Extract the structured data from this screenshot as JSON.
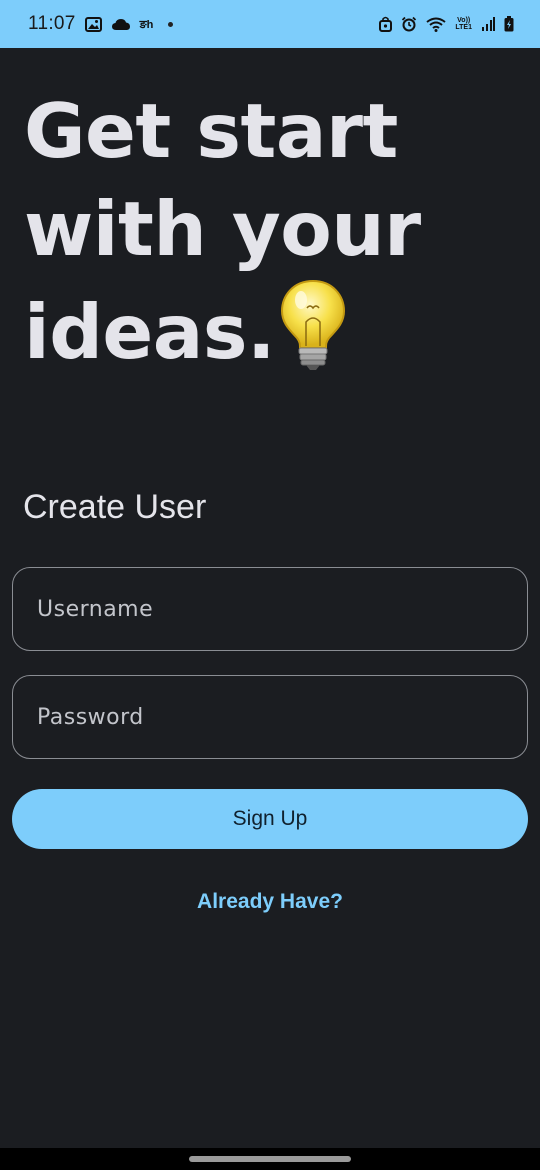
{
  "status_bar": {
    "time": "11:07",
    "bengali_glyph": "ङh",
    "volte_top": "Vo))",
    "volte_bottom": "LTE1",
    "background": "#7dcdfb"
  },
  "headline": {
    "line1": "Get start",
    "line2": "with your",
    "line3": "ideas.",
    "emoji_icon": "light-bulb-icon"
  },
  "form": {
    "title": "Create User",
    "username_placeholder": "Username",
    "username_value": "",
    "password_placeholder": "Password",
    "password_value": "",
    "signup_label": "Sign Up",
    "already_have_label": "Already Have?"
  },
  "colors": {
    "background": "#1b1d21",
    "accent": "#7dcdfb",
    "text": "#e4e4ea"
  }
}
